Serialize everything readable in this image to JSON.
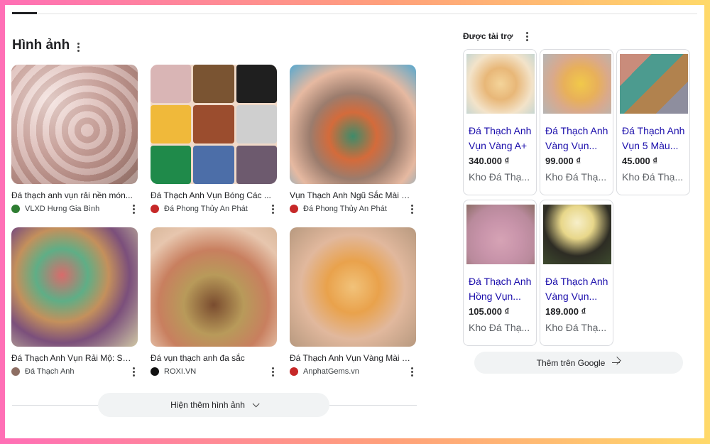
{
  "images": {
    "title": "Hình ảnh",
    "items": [
      {
        "caption": "Đá thạch anh vụn rải nền món...",
        "source": "VLXD Hưng Gia Bình",
        "favicon_color": "#2e7d32"
      },
      {
        "caption": "Đá Thạch Anh Vụn Bóng Các ...",
        "source": "Đá Phong Thủy An Phát",
        "favicon_color": "#c62828"
      },
      {
        "caption": "Vụn Thạch Anh Ngũ Sắc Mài B...",
        "source": "Đá Phong Thủy An Phát",
        "favicon_color": "#c62828"
      },
      {
        "caption": "Đá Thạch Anh Vụn Rải Mộ: Sức...",
        "source": "Đá Thạch Anh",
        "favicon_color": "#8d6e63"
      },
      {
        "caption": "Đá vụn thạch anh đa sắc",
        "source": "ROXI.VN",
        "favicon_color": "#111111"
      },
      {
        "caption": "Đá Thạch Anh Vụn Vàng Mài B...",
        "source": "AnphatGems.vn",
        "favicon_color": "#c62828"
      }
    ],
    "more_label": "Hiện thêm hình ảnh"
  },
  "sponsored": {
    "title": "Được tài trợ",
    "products": [
      {
        "line1": "Đá Thạch Anh",
        "line2": "Vụn Vàng A+",
        "price": "340.000 ₫",
        "seller": "Kho Đá Thạ..."
      },
      {
        "line1": "Đá Thạch Anh",
        "line2": "Vàng Vụn...",
        "price": "99.000 ₫",
        "seller": "Kho Đá Thạ..."
      },
      {
        "line1": "Đá Thạch Anh",
        "line2": "Vụn 5 Màu...",
        "price": "45.000 ₫",
        "seller": "Kho Đá Thạ..."
      },
      {
        "line1": "Đá Thạch Anh",
        "line2": "Hồng Vụn...",
        "price": "105.000 ₫",
        "seller": "Kho Đá Thạ..."
      },
      {
        "line1": "Đá Thạch Anh",
        "line2": "Vàng Vụn...",
        "price": "189.000 ₫",
        "seller": "Kho Đá Thạ..."
      }
    ],
    "more_label": "Thêm trên Google"
  },
  "icons": {
    "menu": "more-vert-icon",
    "expand": "chevron-down-icon",
    "forward": "arrow-right-icon"
  }
}
